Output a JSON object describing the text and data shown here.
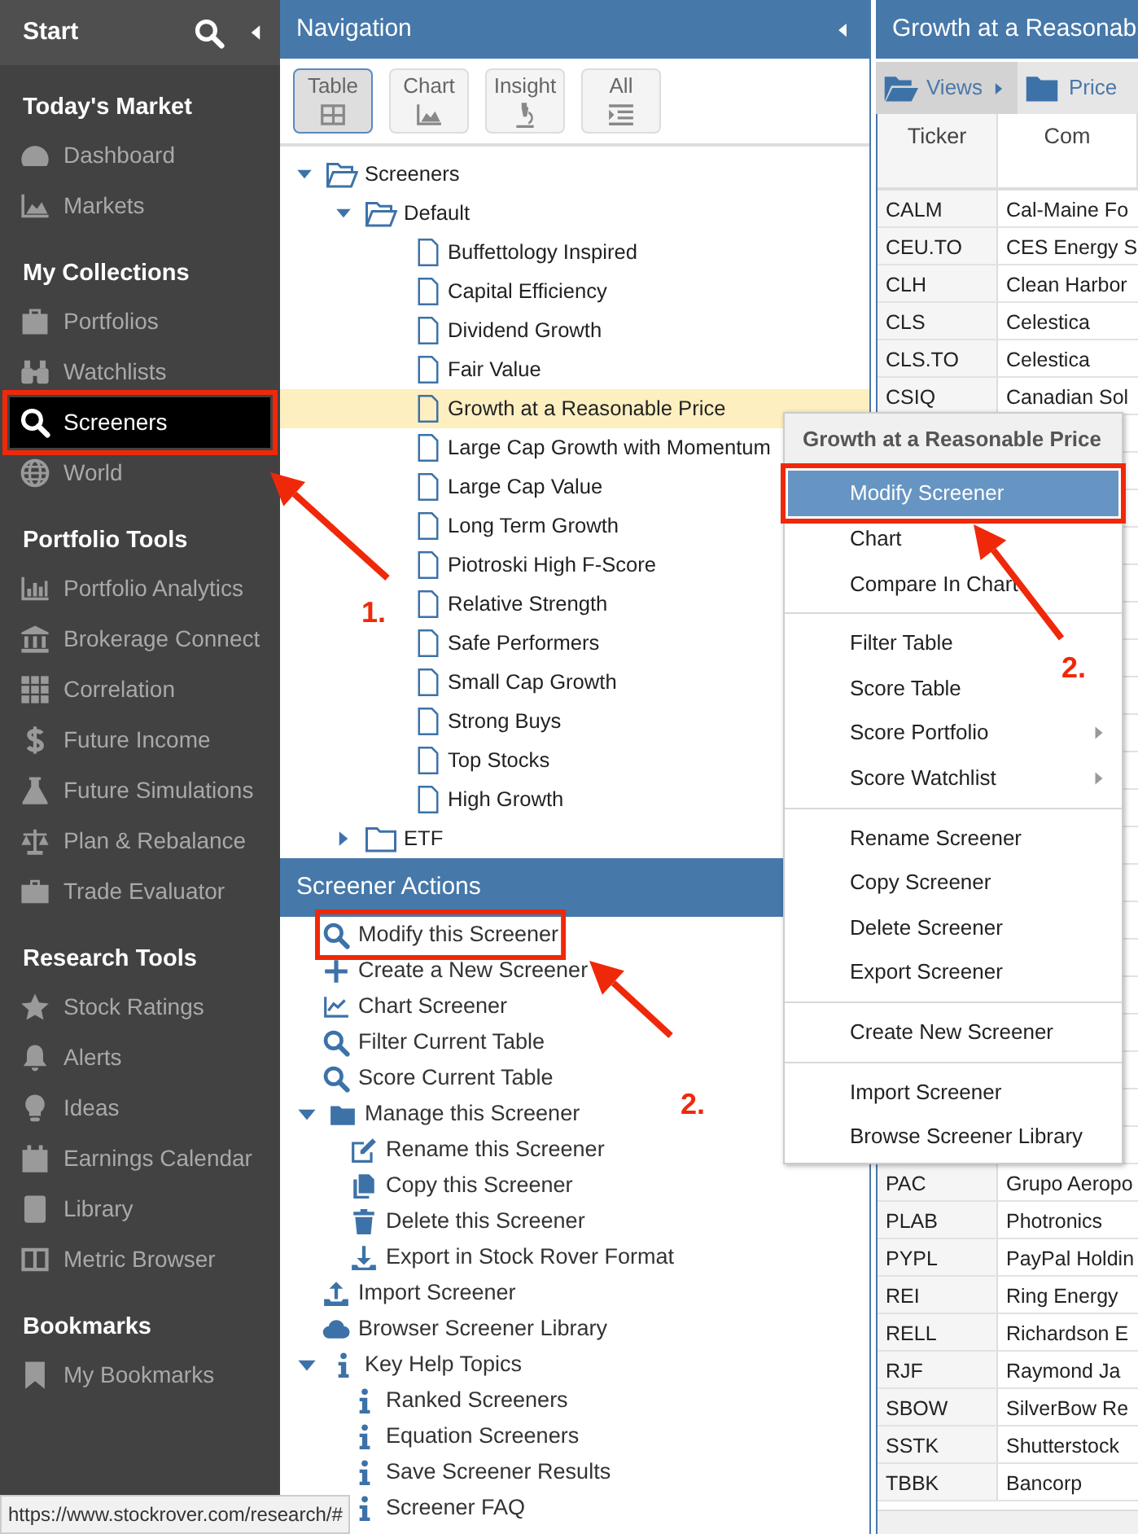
{
  "sidebar": {
    "title": "Start",
    "sections": [
      {
        "heading": "Today's Market",
        "items": [
          {
            "label": "Dashboard",
            "selected": false
          },
          {
            "label": "Markets",
            "selected": false
          }
        ]
      },
      {
        "heading": "My Collections",
        "items": [
          {
            "label": "Portfolios",
            "selected": false
          },
          {
            "label": "Watchlists",
            "selected": false
          },
          {
            "label": "Screeners",
            "selected": true
          },
          {
            "label": "World",
            "selected": false
          }
        ]
      },
      {
        "heading": "Portfolio Tools",
        "items": [
          {
            "label": "Portfolio Analytics",
            "selected": false
          },
          {
            "label": "Brokerage Connect",
            "selected": false
          },
          {
            "label": "Correlation",
            "selected": false
          },
          {
            "label": "Future Income",
            "selected": false
          },
          {
            "label": "Future Simulations",
            "selected": false
          },
          {
            "label": "Plan & Rebalance",
            "selected": false
          },
          {
            "label": "Trade Evaluator",
            "selected": false
          }
        ]
      },
      {
        "heading": "Research Tools",
        "items": [
          {
            "label": "Stock Ratings",
            "selected": false
          },
          {
            "label": "Alerts",
            "selected": false
          },
          {
            "label": "Ideas",
            "selected": false
          },
          {
            "label": "Earnings Calendar",
            "selected": false
          },
          {
            "label": "Library",
            "selected": false
          },
          {
            "label": "Metric Browser",
            "selected": false
          }
        ]
      },
      {
        "heading": "Bookmarks",
        "items": [
          {
            "label": "My Bookmarks",
            "selected": false
          }
        ]
      }
    ]
  },
  "navigation": {
    "title": "Navigation",
    "view_tabs": [
      {
        "label": "Table",
        "selected": true
      },
      {
        "label": "Chart",
        "selected": false
      },
      {
        "label": "Insight",
        "selected": false
      },
      {
        "label": "All",
        "selected": false
      }
    ],
    "tree": [
      {
        "label": "Screeners",
        "expanded": true,
        "children": [
          {
            "label": "Default",
            "expanded": true,
            "children": [
              {
                "label": "Buffettology Inspired",
                "selected": false
              },
              {
                "label": "Capital Efficiency",
                "selected": false
              },
              {
                "label": "Dividend Growth",
                "selected": false
              },
              {
                "label": "Fair Value",
                "selected": false
              },
              {
                "label": "Growth at a Reasonable Price",
                "selected": true
              },
              {
                "label": "Large Cap Growth with Momentum",
                "selected": false
              },
              {
                "label": "Large Cap Value",
                "selected": false
              },
              {
                "label": "Long Term Growth",
                "selected": false
              },
              {
                "label": "Piotroski High F-Score",
                "selected": false
              },
              {
                "label": "Relative Strength",
                "selected": false
              },
              {
                "label": "Safe Performers",
                "selected": false
              },
              {
                "label": "Small Cap Growth",
                "selected": false
              },
              {
                "label": "Strong Buys",
                "selected": false
              },
              {
                "label": "Top Stocks",
                "selected": false
              },
              {
                "label": "High Growth",
                "selected": false
              }
            ]
          },
          {
            "label": "ETF",
            "expanded": false
          }
        ]
      }
    ]
  },
  "screener_actions": {
    "title": "Screener Actions",
    "items": [
      {
        "label": "Modify this Screener"
      },
      {
        "label": "Create a New Screener"
      },
      {
        "label": "Chart Screener"
      },
      {
        "label": "Filter Current Table"
      },
      {
        "label": "Score Current Table"
      },
      {
        "label": "Manage this Screener",
        "expanded": true,
        "children": [
          {
            "label": "Rename this Screener"
          },
          {
            "label": "Copy this Screener"
          },
          {
            "label": "Delete this Screener"
          },
          {
            "label": "Export in Stock Rover Format"
          }
        ]
      },
      {
        "label": "Import Screener"
      },
      {
        "label": "Browser Screener Library"
      },
      {
        "label": "Key Help Topics",
        "expanded": true,
        "children": [
          {
            "label": "Ranked Screeners"
          },
          {
            "label": "Equation Screeners"
          },
          {
            "label": "Save Screener Results"
          },
          {
            "label": "Screener FAQ"
          }
        ]
      }
    ]
  },
  "results": {
    "title": "Growth at a Reasonab",
    "toolbar": [
      "Views",
      "Price"
    ],
    "columns": [
      "Ticker",
      "Com"
    ],
    "rows_top": [
      {
        "ticker": "CALM",
        "company": "Cal-Maine Fo"
      },
      {
        "ticker": "CEU.TO",
        "company": "CES Energy S"
      },
      {
        "ticker": "CLH",
        "company": "Clean Harbor"
      },
      {
        "ticker": "CLS",
        "company": "Celestica"
      },
      {
        "ticker": "CLS.TO",
        "company": "Celestica"
      },
      {
        "ticker": "CSIQ",
        "company": "Canadian Sol"
      }
    ],
    "rows_bottom": [
      {
        "ticker": "PAC",
        "company": "Grupo Aeropo"
      },
      {
        "ticker": "PLAB",
        "company": "Photronics"
      },
      {
        "ticker": "PYPL",
        "company": "PayPal Holdin"
      },
      {
        "ticker": "REI",
        "company": "Ring Energy"
      },
      {
        "ticker": "RELL",
        "company": "Richardson E"
      },
      {
        "ticker": "RJF",
        "company": "Raymond Ja"
      },
      {
        "ticker": "SBOW",
        "company": "SilverBow Re"
      },
      {
        "ticker": "SSTK",
        "company": "Shutterstock"
      },
      {
        "ticker": "TBBK",
        "company": "Bancorp"
      }
    ]
  },
  "context_menu": {
    "title": "Growth at a Reasonable Price",
    "groups": [
      [
        {
          "label": "Modify Screener",
          "selected": true,
          "submenu": false
        },
        {
          "label": "Chart",
          "selected": false,
          "submenu": false
        },
        {
          "label": "Compare In Chart",
          "selected": false,
          "submenu": false
        }
      ],
      [
        {
          "label": "Filter Table",
          "selected": false,
          "submenu": false
        },
        {
          "label": "Score Table",
          "selected": false,
          "submenu": false
        },
        {
          "label": "Score Portfolio",
          "selected": false,
          "submenu": true
        },
        {
          "label": "Score Watchlist",
          "selected": false,
          "submenu": true
        }
      ],
      [
        {
          "label": "Rename Screener",
          "selected": false,
          "submenu": false
        },
        {
          "label": "Copy Screener",
          "selected": false,
          "submenu": false
        },
        {
          "label": "Delete Screener",
          "selected": false,
          "submenu": false
        },
        {
          "label": "Export Screener",
          "selected": false,
          "submenu": false
        }
      ],
      [
        {
          "label": "Create New Screener",
          "selected": false,
          "submenu": false
        }
      ],
      [
        {
          "label": "Import Screener",
          "selected": false,
          "submenu": false
        },
        {
          "label": "Browse Screener Library",
          "selected": false,
          "submenu": false
        }
      ]
    ]
  },
  "annotations": [
    {
      "label": "1."
    },
    {
      "label": "2."
    },
    {
      "label": "2."
    }
  ],
  "status_url": "https://www.stockrover.com/research/#"
}
